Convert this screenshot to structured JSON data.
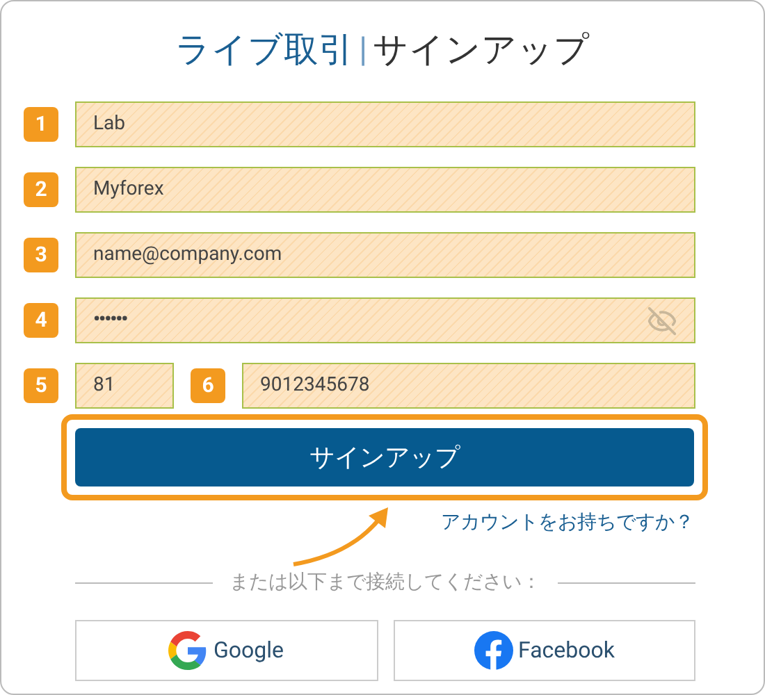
{
  "title": {
    "primary": "ライブ取引",
    "separator": "|",
    "secondary": "サインアップ"
  },
  "fields": [
    {
      "badge": "1",
      "value": "Lab",
      "kind": "text"
    },
    {
      "badge": "2",
      "value": "Myforex",
      "kind": "text"
    },
    {
      "badge": "3",
      "value": "name@company.com",
      "kind": "text"
    },
    {
      "badge": "4",
      "value": "••••••",
      "kind": "password"
    }
  ],
  "phone": {
    "code_badge": "5",
    "code": "81",
    "number_badge": "6",
    "number": "9012345678"
  },
  "submit": {
    "label": "サインアップ",
    "highlighted": true
  },
  "login_link": "アカウントをお持ちですか？",
  "divider_text": "または以下まで接続してください：",
  "social": [
    {
      "kind": "google",
      "label": "Google"
    },
    {
      "kind": "facebook",
      "label": "Facebook"
    }
  ]
}
